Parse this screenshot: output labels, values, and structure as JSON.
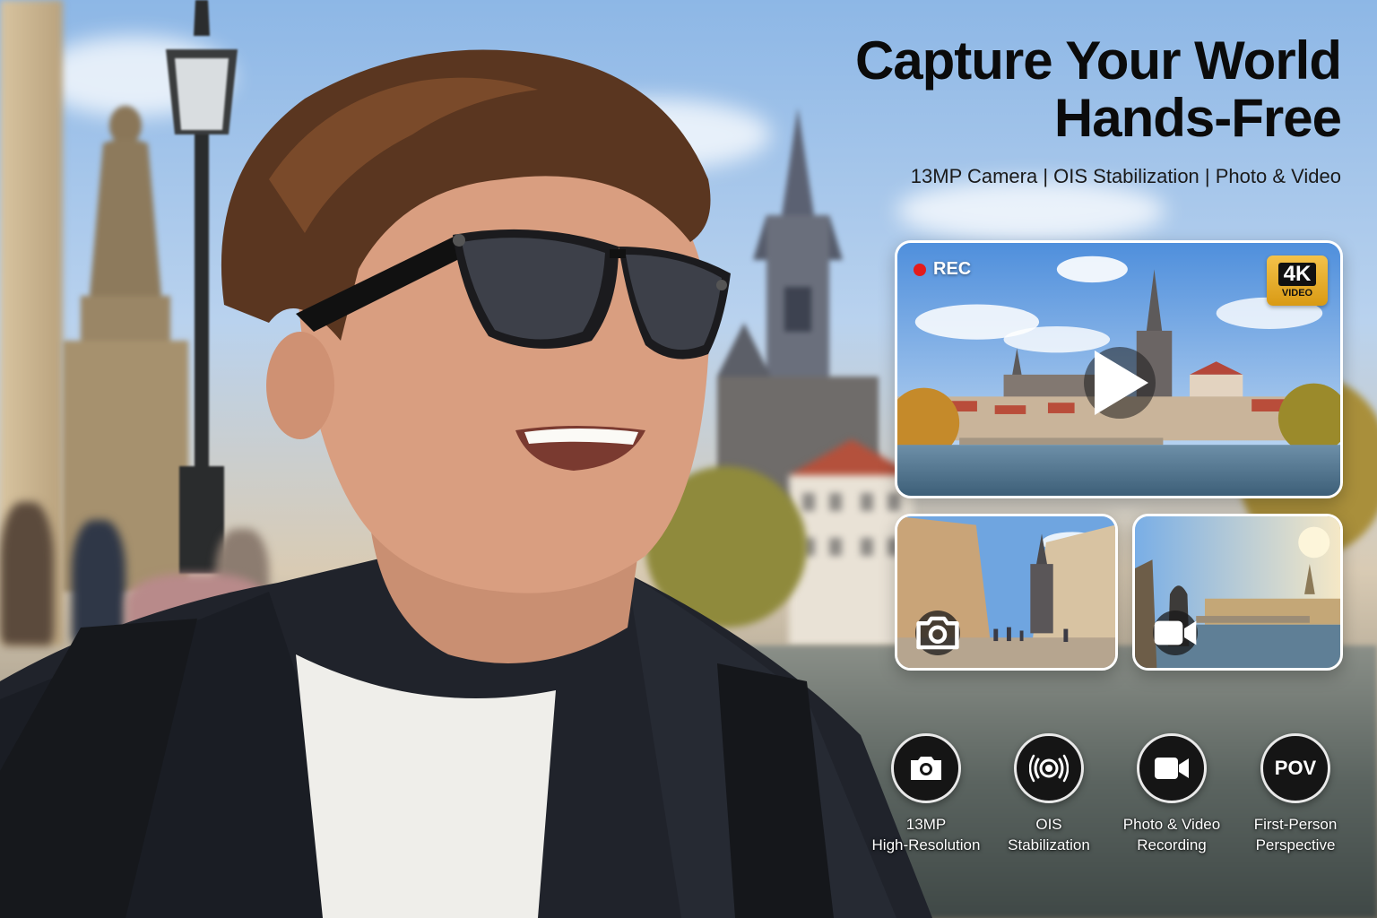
{
  "headline": {
    "title_line1": "Capture Your World",
    "title_line2": "Hands-Free",
    "subtitle": "13MP Camera | OIS Stabilization | Photo & Video"
  },
  "main_video_card": {
    "rec_label": "REC",
    "badge_main": "4K",
    "badge_sub": "VIDEO"
  },
  "photo_card": {
    "icon": "camera-icon"
  },
  "video_card": {
    "icon": "video-camera-icon"
  },
  "features": [
    {
      "icon": "camera-icon",
      "line1": "13MP",
      "line2": "High-Resolution"
    },
    {
      "icon": "stabilization-icon",
      "line1": "OIS",
      "line2": "Stabilization"
    },
    {
      "icon": "video-camera-icon",
      "line1": "Photo & Video",
      "line2": "Recording"
    },
    {
      "icon_text": "POV",
      "line1": "First-Person",
      "line2": "Perspective"
    }
  ],
  "colors": {
    "rec_dot": "#e31b1b",
    "badge_gold": "#f4c24a",
    "feature_circle": "#151515"
  }
}
